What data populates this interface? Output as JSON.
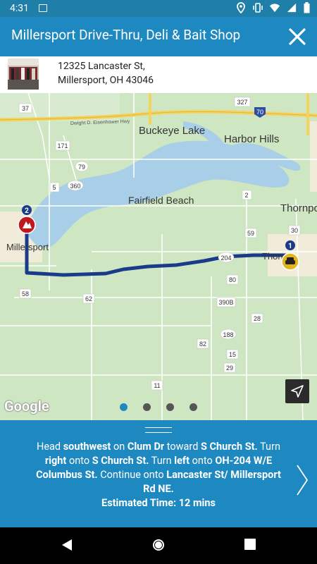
{
  "status_bar": {
    "time": "4:31"
  },
  "header": {
    "title": "Millersport Drive-Thru, Deli & Bait Shop"
  },
  "address": {
    "line1": "12325 Lancaster St,",
    "line2": "Millersport, OH 43046"
  },
  "map": {
    "labels": {
      "buckeye_lake": "Buckeye Lake",
      "harbor_hills": "Harbor Hills",
      "fairfield_beach": "Fairfield Beach",
      "thornport": "Thornpo",
      "millersport": "Millersport",
      "thornville": "Thorn",
      "highway": "Dwight D. Eisenhower Hwy"
    },
    "route_shields": [
      "37",
      "327",
      "70",
      "171",
      "79",
      "360",
      "5",
      "2",
      "59",
      "30",
      "204",
      "80",
      "390B",
      "28",
      "58",
      "62",
      "188",
      "82",
      "15",
      "29",
      "11"
    ],
    "markers": {
      "destination_number": "2",
      "origin_number": "1"
    },
    "attribution": "Google",
    "pager": {
      "count": 4,
      "active_index": 0
    }
  },
  "directions": {
    "parts": [
      {
        "t": "Head ",
        "b": false
      },
      {
        "t": "southwest",
        "b": true
      },
      {
        "t": " on ",
        "b": false
      },
      {
        "t": "Clum Dr",
        "b": true
      },
      {
        "t": " toward ",
        "b": false
      },
      {
        "t": "S Church St.",
        "b": true
      },
      {
        "t": " Turn ",
        "b": false
      },
      {
        "t": "right",
        "b": true
      },
      {
        "t": " onto ",
        "b": false
      },
      {
        "t": "S Church St.",
        "b": true
      },
      {
        "t": " Turn ",
        "b": false
      },
      {
        "t": "left",
        "b": true
      },
      {
        "t": " onto ",
        "b": false
      },
      {
        "t": "OH-204 W/E Columbus St.",
        "b": true
      },
      {
        "t": " Continue onto ",
        "b": false
      },
      {
        "t": "Lancaster St/ Millersport Rd NE.",
        "b": true
      }
    ],
    "estimated_time": "Estimated Time: 12 mins"
  },
  "colors": {
    "accent": "#1e88c0",
    "status": "#1f7fa8",
    "route": "#1a3a8a",
    "water": "#a9cfe8",
    "land": "#cfe6c3"
  }
}
